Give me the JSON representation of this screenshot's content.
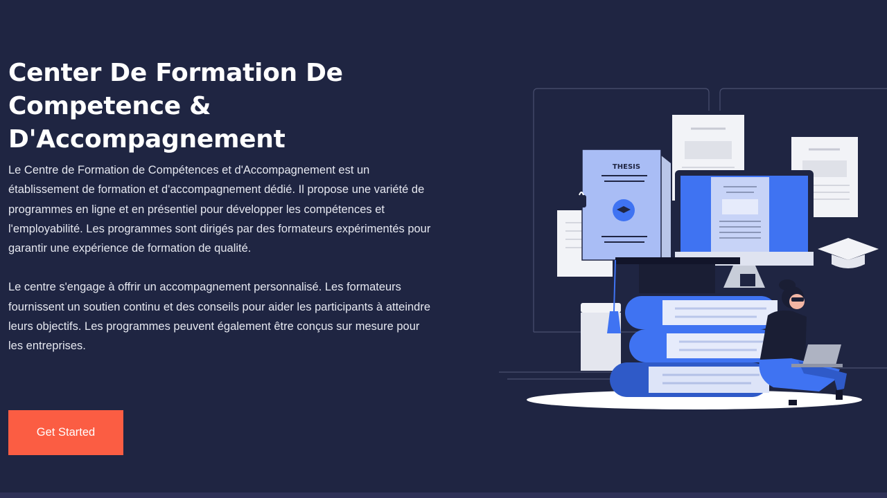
{
  "hero": {
    "title": "Center De Formation De Competence & D'Accompagnement",
    "paragraph_1": "Le Centre de Formation de Compétences et d'Accompagnement est un établissement de formation et d'accompagnement dédié. Il propose une variété de programmes en ligne et en présentiel pour développer les compétences et l'employabilité. Les programmes sont dirigés par des formateurs expérimentés pour garantir une expérience de formation de qualité.",
    "paragraph_2": "Le centre s'engage à offrir un accompagnement personnalisé. Les formateurs fournissent un soutien continu et des conseils pour aider les participants à atteindre leurs objectifs. Les programmes peuvent également être conçus sur mesure pour les entreprises.",
    "cta_label": "Get Started"
  },
  "illustration": {
    "thesis_label": "THESIS"
  },
  "colors": {
    "background": "#1f2542",
    "accent": "#fb5d43",
    "illustration_blue": "#3f73f2"
  }
}
